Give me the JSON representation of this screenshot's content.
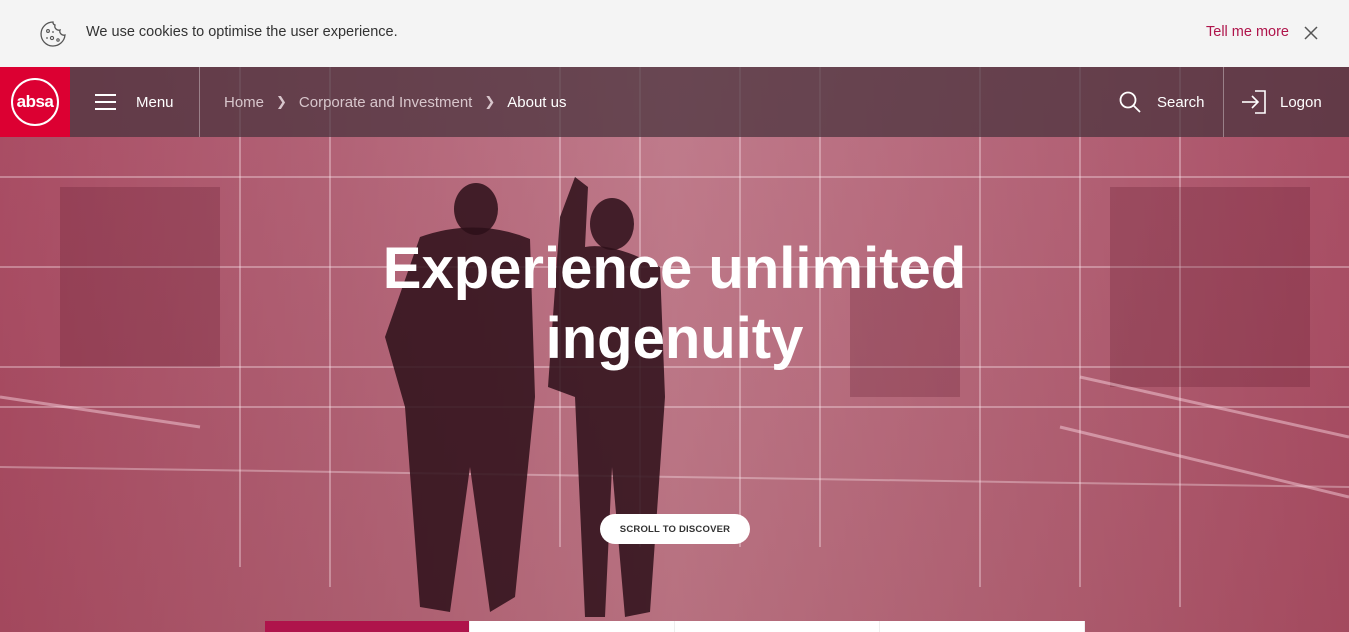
{
  "cookie": {
    "message": "We use cookies to optimise the user experience.",
    "link": "Tell me more",
    "icon": "cookie-icon"
  },
  "nav": {
    "logo_text": "absa",
    "menu_label": "Menu",
    "breadcrumb": [
      "Home",
      "Corporate and Investment",
      "About us"
    ],
    "search_label": "Search",
    "logon_label": "Logon"
  },
  "hero": {
    "headline_line1": "Experience unlimited",
    "headline_line2": "ingenuity",
    "scroll_label": "SCROLL TO DISCOVER"
  },
  "colors": {
    "brand_red": "#dc0032",
    "link_red": "#af144b",
    "overlay": "#a03250"
  }
}
